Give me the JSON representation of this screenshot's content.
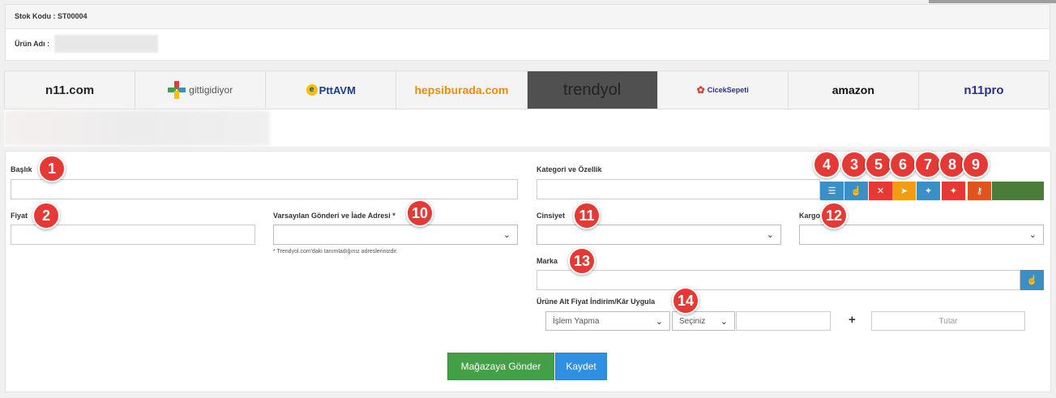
{
  "header": {
    "stock_code_label": "Stok Kodu : ST00004",
    "product_name_label": "Ürün Adı :"
  },
  "marketplaces": [
    {
      "name": "n11.com",
      "color": "#222222"
    },
    {
      "name": "gittigidiyor",
      "color": "#555555"
    },
    {
      "name": "PttAVM",
      "color": "#1a3d8f"
    },
    {
      "name": "hepsiburada.com",
      "color": "#f28b00"
    },
    {
      "name": "trendyol",
      "color": "#222222",
      "active": true
    },
    {
      "name": "CicekSepeti",
      "color": "#2b2f8f"
    },
    {
      "name": "amazon",
      "color": "#111111"
    },
    {
      "name": "n11pro",
      "color": "#2b2f8f"
    }
  ],
  "form": {
    "title_label": "Başlık",
    "price_label": "Fiyat",
    "shipping_label": "Varsayılan Gönderi ve İade Adresi *",
    "shipping_hint": "* Trendyol.com'daki tanımladığınız adreslerinizdir.",
    "category_label": "Kategori ve Özellik",
    "gender_label": "Cinsiyet",
    "cargo_label": "Kargo",
    "brand_label": "Marka",
    "discount_label": "Ürüne Alt Fiyat İndirim/Kâr Uygula",
    "discount_action": "İşlem Yapma",
    "discount_type": "Seçiniz",
    "amount_placeholder": "Tutar",
    "plus": "+"
  },
  "actions": {
    "send_label": "Mağazaya Gönder",
    "save_label": "Kaydet"
  },
  "badges": [
    "1",
    "2",
    "3",
    "4",
    "5",
    "6",
    "7",
    "8",
    "9",
    "10",
    "11",
    "12",
    "13",
    "14"
  ],
  "icon_buttons": [
    {
      "icon": "sliders-icon",
      "glyph": "☰",
      "color": "#3b8fc7"
    },
    {
      "icon": "hand-pointer-icon",
      "glyph": "☝",
      "color": "#3b8fc7"
    },
    {
      "icon": "close-icon",
      "glyph": "✕",
      "color": "#e53935"
    },
    {
      "icon": "send-icon",
      "glyph": "➤",
      "color": "#f39c12"
    },
    {
      "icon": "magic-wand-icon",
      "glyph": "✦",
      "color": "#3b8fc7"
    },
    {
      "icon": "magic-wand-icon",
      "glyph": "✦",
      "color": "#e53935"
    },
    {
      "icon": "key-icon",
      "glyph": "⚷",
      "color": "#e0541e"
    }
  ],
  "colors": {
    "accent": "#3b8fc7",
    "green": "#43a047",
    "badge": "#e53935"
  }
}
